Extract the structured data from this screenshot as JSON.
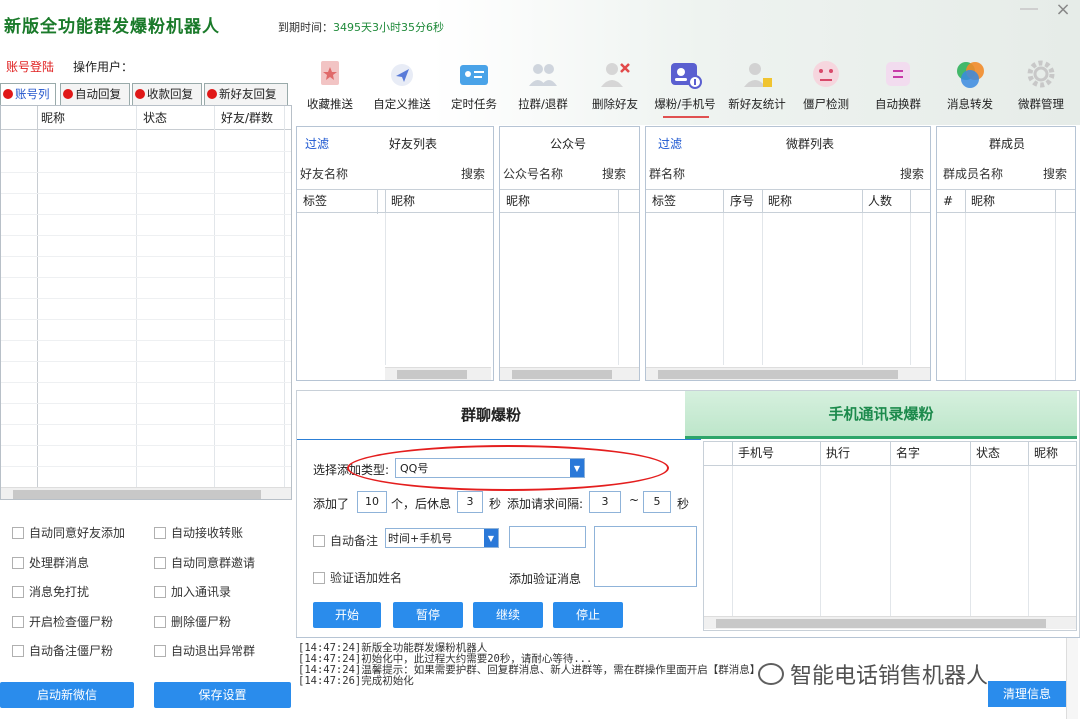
{
  "header": {
    "title": "新版全功能群发爆粉机器人",
    "expire_label": "到期时间：",
    "expire_value": "3495天3小时35分6秒",
    "close_glyph": "×",
    "account_login": "账号登陆",
    "operator_label": "操作用户："
  },
  "toolbar": [
    {
      "label": "收藏推送",
      "icon": "star-icon"
    },
    {
      "label": "自定义推送",
      "icon": "send-icon"
    },
    {
      "label": "定时任务",
      "icon": "id-card-icon"
    },
    {
      "label": "拉群/退群",
      "icon": "group-icon"
    },
    {
      "label": "删除好友",
      "icon": "delete-user-icon"
    },
    {
      "label": "爆粉/手机号",
      "icon": "contacts-icon"
    },
    {
      "label": "新好友统计",
      "icon": "user-stats-icon"
    },
    {
      "label": "僵尸检测",
      "icon": "zombie-icon"
    },
    {
      "label": "自动换群",
      "icon": "switch-group-icon"
    },
    {
      "label": "消息转发",
      "icon": "forward-icon"
    },
    {
      "label": "微群管理",
      "icon": "gear-icon"
    }
  ],
  "left": {
    "tabs": [
      "账号列",
      "自动回复",
      "收款回复",
      "新好友回复"
    ],
    "columns": [
      "昵称",
      "状态",
      "好友/群数"
    ],
    "options": [
      [
        "自动同意好友添加",
        "自动接收转账"
      ],
      [
        "处理群消息",
        "自动同意群邀请"
      ],
      [
        "消息免打扰",
        "加入通讯录"
      ],
      [
        "开启检查僵尸粉",
        "删除僵尸粉"
      ],
      [
        "自动备注僵尸粉",
        "自动退出异常群"
      ]
    ],
    "btn_new_wechat": "启动新微信",
    "btn_save": "保存设置"
  },
  "panels": {
    "friends": {
      "filter": "过滤",
      "title": "好友列表",
      "field": "好友名称",
      "search": "搜索",
      "cols": [
        "标签",
        "昵称"
      ]
    },
    "official": {
      "title": "公众号",
      "field": "公众号名称",
      "search": "搜索",
      "cols": [
        "昵称"
      ]
    },
    "groups": {
      "filter": "过滤",
      "title": "微群列表",
      "field": "群名称",
      "search": "搜索",
      "cols": [
        "标签",
        "序号",
        "昵称",
        "人数"
      ]
    },
    "members": {
      "title": "群成员",
      "field": "群成员名称",
      "search": "搜索",
      "cols": [
        "#",
        "昵称"
      ]
    }
  },
  "work": {
    "tab_group": "群聊爆粉",
    "tab_phone": "手机通讯录爆粉",
    "type_label": "选择添加类型:",
    "type_value": "QQ号",
    "added_label": "添加了",
    "added_value": "10",
    "rest_label": "个，后休息",
    "rest_value": "3",
    "sec_label": "秒",
    "interval_label": "添加请求间隔:",
    "interval_min": "3",
    "interval_dash": "~",
    "interval_max": "5",
    "sec_label2": "秒",
    "auto_remark": "自动备注",
    "remark_value": "时间+手机号",
    "verify_add_name": "验证语加姓名",
    "add_verify_msg": "添加验证消息",
    "btn_start": "开始",
    "btn_pause": "暂停",
    "btn_continue": "继续",
    "btn_stop": "停止",
    "phone_cols": [
      "手机号",
      "执行",
      "名字",
      "状态",
      "昵称"
    ]
  },
  "log": {
    "lines": [
      "[14:47:24]新版全功能群发爆粉机器人",
      "[14:47:24]初始化中，此过程大约需要20秒，请耐心等待...",
      "[14:47:24]温馨提示：如果需要护群、回复群消息、新人进群等，需在群操作里面开启【群消息】",
      "[14:47:26]完成初始化"
    ],
    "watermark": "智能电话销售机器人",
    "clear_btn": "清理信息"
  }
}
